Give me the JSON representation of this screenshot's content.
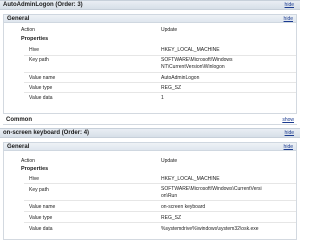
{
  "items": [
    {
      "title": "AutoAdminLogon (Order: 3)",
      "hide_label": "hide",
      "general": {
        "title": "General",
        "hide_label": "hide",
        "action_label": "Action",
        "action_value": "Update",
        "properties_title": "Properties",
        "props": [
          {
            "label": "Hive",
            "value": "HKEY_LOCAL_MACHINE"
          },
          {
            "label": "Key path",
            "value_l1": "SOFTWARE\\Microsoft\\Windows",
            "value_l2": "NT\\CurrentVersion\\Winlogon"
          },
          {
            "label": "Value name",
            "value": "AutoAdminLogon"
          },
          {
            "label": "Value type",
            "value": "REG_SZ"
          },
          {
            "label": "Value data",
            "value": "1"
          }
        ]
      },
      "common": {
        "title": "Common",
        "show_label": "show"
      }
    },
    {
      "title": "on-screen keyboard (Order: 4)",
      "hide_label": "hide",
      "general": {
        "title": "General",
        "hide_label": "hide",
        "action_label": "Action",
        "action_value": "Update",
        "properties_title": "Properties",
        "props": [
          {
            "label": "Hive",
            "value": "HKEY_LOCAL_MACHINE"
          },
          {
            "label": "Key path",
            "value_l1": "SOFTWARE\\Microsoft\\Windows\\CurrentVersi",
            "value_l2": "on\\Run"
          },
          {
            "label": "Value name",
            "value": "on-screen keyboard"
          },
          {
            "label": "Value type",
            "value": "REG_SZ"
          },
          {
            "label": "Value data",
            "value": "%systemdrive%\\windows\\system32\\osk.exe"
          }
        ]
      }
    }
  ]
}
